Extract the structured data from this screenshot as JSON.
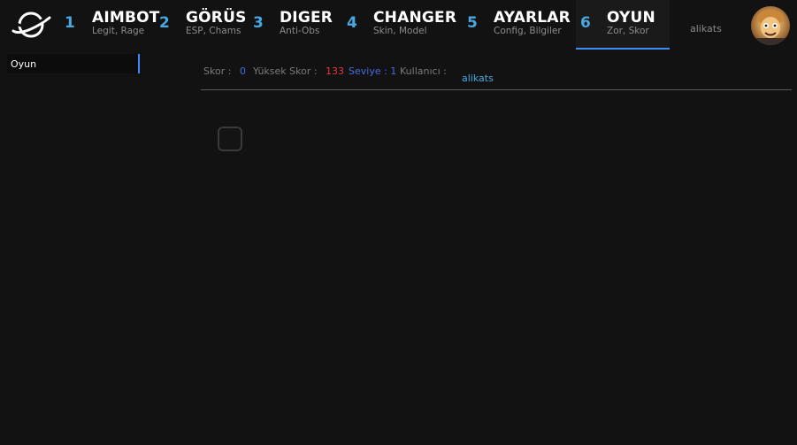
{
  "tabs": [
    {
      "num": "1",
      "title": "AIMBOT",
      "sub": "Legit, Rage"
    },
    {
      "num": "2",
      "title": "GÖRÜS",
      "sub": "ESP, Chams"
    },
    {
      "num": "3",
      "title": "DIGER",
      "sub": "Anti-Obs"
    },
    {
      "num": "4",
      "title": "CHANGER",
      "sub": "Skin, Model"
    },
    {
      "num": "5",
      "title": "AYARLAR",
      "sub": "Config, Bilgiler"
    },
    {
      "num": "6",
      "title": "OYUN",
      "sub": "Zor, Skor"
    }
  ],
  "active_tab": "OYUN",
  "header": {
    "username": "alikats"
  },
  "sidebar": {
    "items": [
      {
        "label": "Oyun"
      }
    ]
  },
  "stats": {
    "score_label": "Skor :",
    "score_value": "0",
    "high_label": "Yüksek Skor :",
    "high_value": "133",
    "level_label": "Seviye : 1",
    "user_label": "Kullanıcı :",
    "user_value": "alikats"
  },
  "colors": {
    "accent": "#3e8ef7",
    "tab_number": "#4aa8e0",
    "score_value": "#3e6ef0",
    "high_value": "#e03a3a",
    "level": "#4a6ae0",
    "username": "#4aa8e0"
  },
  "icons": {
    "logo": "planet-ring-logo-icon",
    "avatar": "user-avatar"
  }
}
